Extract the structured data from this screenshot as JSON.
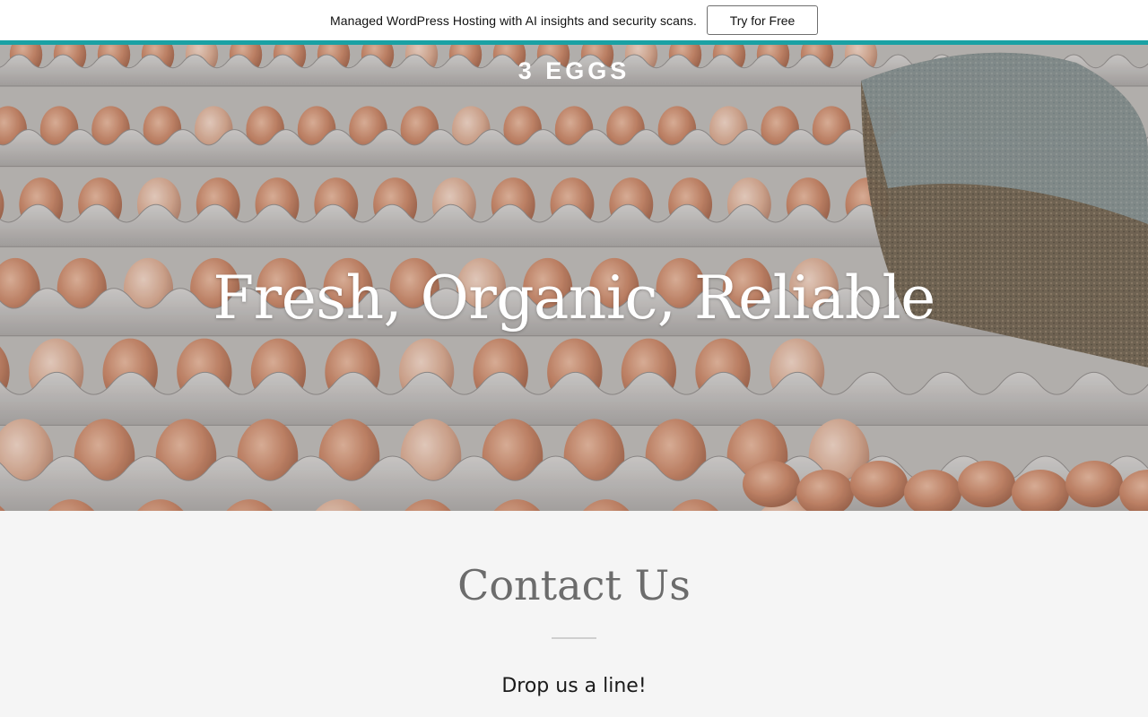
{
  "promo": {
    "text": "Managed WordPress Hosting with AI insights and security scans.",
    "button_label": "Try for Free"
  },
  "colors": {
    "accent_stripe": "#1aa1a4",
    "hero_text": "#ffffff",
    "section_background": "#f5f5f5",
    "heading_text": "#6c6c6c"
  },
  "hero": {
    "logo": "3 EGGS",
    "title": "Fresh, Organic, Reliable",
    "image_subject": "stacked egg cartons with brown eggs and a bag of grain"
  },
  "contact": {
    "heading": "Contact Us",
    "subheading": "Drop us a line!"
  }
}
